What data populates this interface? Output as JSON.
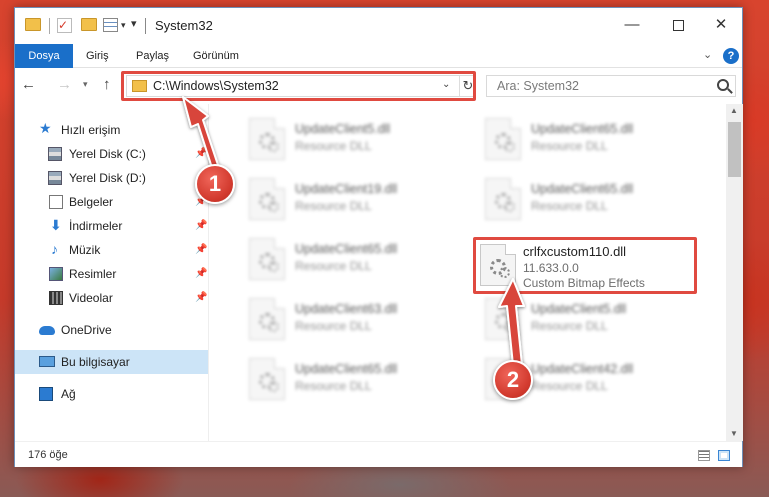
{
  "window": {
    "title": "System32"
  },
  "ribbon": {
    "tabs": [
      {
        "label": "Dosya"
      },
      {
        "label": "Giriş"
      },
      {
        "label": "Paylaş"
      },
      {
        "label": "Görünüm"
      }
    ]
  },
  "address": {
    "path": "C:\\Windows\\System32"
  },
  "search": {
    "placeholder": "Ara: System32"
  },
  "sidebar": {
    "items": [
      {
        "label": "Hızlı erişim",
        "icon": "quick-access-star-icon"
      },
      {
        "label": "Yerel Disk (C:)",
        "icon": "disk-icon",
        "pinned": true
      },
      {
        "label": "Yerel Disk (D:)",
        "icon": "disk-icon",
        "pinned": true
      },
      {
        "label": "Belgeler",
        "icon": "documents-icon",
        "pinned": true
      },
      {
        "label": "İndirmeler",
        "icon": "downloads-icon",
        "pinned": true
      },
      {
        "label": "Müzik",
        "icon": "music-icon",
        "pinned": true
      },
      {
        "label": "Resimler",
        "icon": "pictures-icon",
        "pinned": true
      },
      {
        "label": "Videolar",
        "icon": "videos-icon",
        "pinned": true
      },
      {
        "label": "OneDrive",
        "icon": "onedrive-cloud-icon"
      },
      {
        "label": "Bu bilgisayar",
        "icon": "this-pc-icon",
        "selected": true
      },
      {
        "label": "Ağ",
        "icon": "network-icon"
      }
    ]
  },
  "files": [
    {
      "name": "UpdateClient5.dll",
      "desc": "Resource DLL"
    },
    {
      "name": "UpdateClient65.dll",
      "desc": "Resource DLL"
    },
    {
      "name": "UpdateClient19.dll",
      "desc": "Resource DLL"
    },
    {
      "name": "UpdateClient65.dll",
      "desc": "Resource DLL"
    },
    {
      "name": "UpdateClient65.dll",
      "desc": "Resource DLL"
    },
    {
      "name": "UpdateClient63.dll",
      "desc": "Resource DLL"
    },
    {
      "name": "UpdateClient5.dll",
      "desc": "Resource DLL"
    },
    {
      "name": "UpdateClient65.dll",
      "desc": "Resource DLL"
    },
    {
      "name": "UpdateClient42.dll",
      "desc": "Resource DLL"
    }
  ],
  "target_file": {
    "name": "crlfxcustom110.dll",
    "version": "11.633.0.0",
    "desc": "Custom Bitmap Effects"
  },
  "status": {
    "count": "176 öğe"
  },
  "annotations": {
    "badge_1": "1",
    "badge_2": "2",
    "color": "#e04a40"
  }
}
